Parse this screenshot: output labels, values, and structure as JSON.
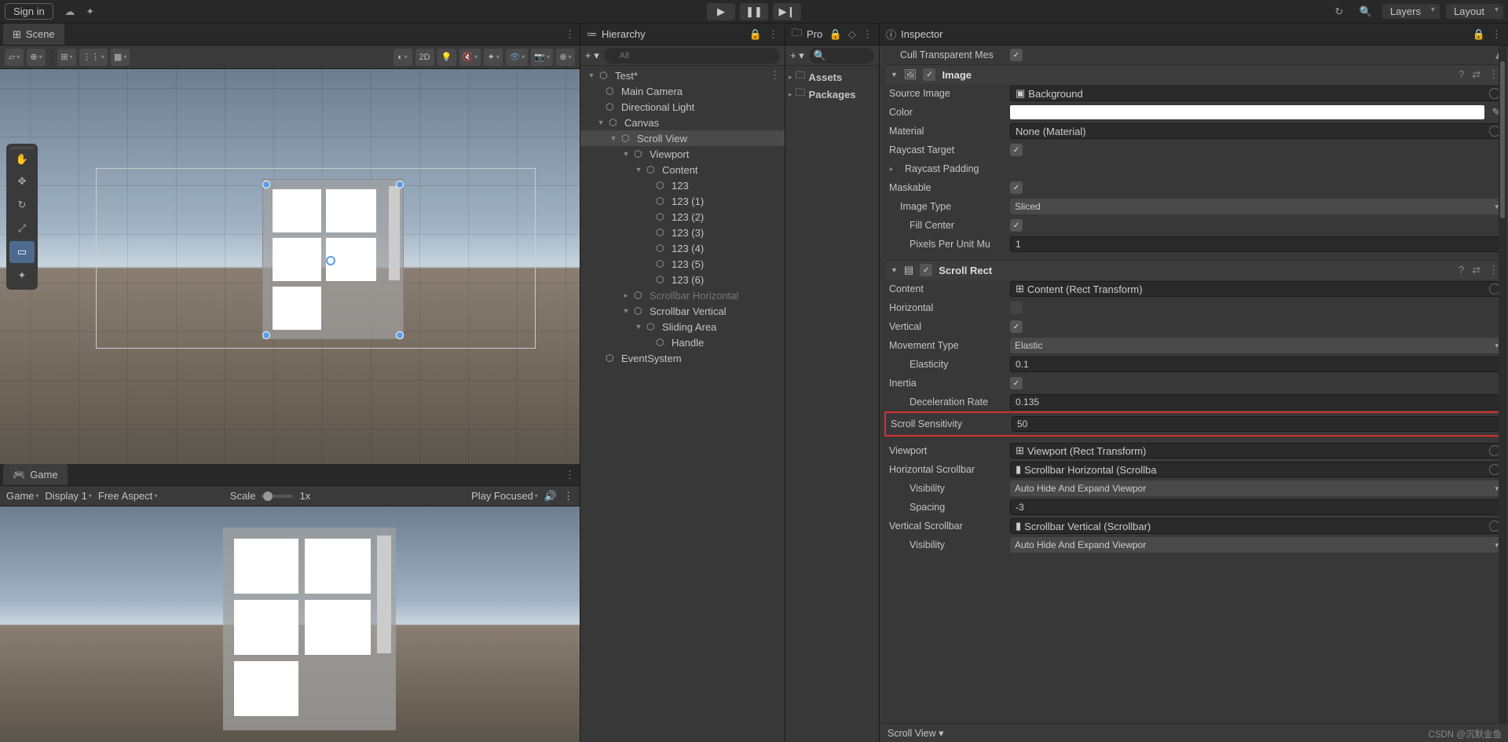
{
  "topbar": {
    "signin": "Sign in",
    "layers": "Layers",
    "layout": "Layout"
  },
  "scene": {
    "tab": "Scene",
    "btn2d": "2D"
  },
  "game": {
    "tab": "Game",
    "game": "Game",
    "display": "Display 1",
    "aspect": "Free Aspect",
    "scale_label": "Scale",
    "scale_value": "1x",
    "play_focused": "Play Focused"
  },
  "hierarchy": {
    "title": "Hierarchy",
    "search_placeholder": "All",
    "items": [
      "Test*",
      "Main Camera",
      "Directional Light",
      "Canvas",
      "Scroll View",
      "Viewport",
      "Content",
      "123",
      "123 (1)",
      "123 (2)",
      "123 (3)",
      "123 (4)",
      "123 (5)",
      "123 (6)",
      "Scrollbar Horizontal",
      "Scrollbar Vertical",
      "Sliding Area",
      "Handle",
      "EventSystem"
    ]
  },
  "project": {
    "title": "Pro",
    "assets": "Assets",
    "packages": "Packages"
  },
  "inspector": {
    "title": "Inspector",
    "cull_transparent": "Cull Transparent Mes",
    "image": {
      "title": "Image",
      "source_image_label": "Source Image",
      "source_image": "Background",
      "color_label": "Color",
      "material_label": "Material",
      "material": "None (Material)",
      "raycast_target_label": "Raycast Target",
      "raycast_padding_label": "Raycast Padding",
      "maskable_label": "Maskable",
      "image_type_label": "Image Type",
      "image_type": "Sliced",
      "fill_center_label": "Fill Center",
      "ppu_label": "Pixels Per Unit Mu",
      "ppu": "1"
    },
    "scroll_rect": {
      "title": "Scroll Rect",
      "content_label": "Content",
      "content": "Content (Rect Transform)",
      "horizontal_label": "Horizontal",
      "vertical_label": "Vertical",
      "movement_type_label": "Movement Type",
      "movement_type": "Elastic",
      "elasticity_label": "Elasticity",
      "elasticity": "0.1",
      "inertia_label": "Inertia",
      "deceleration_label": "Deceleration Rate",
      "deceleration": "0.135",
      "scroll_sensitivity_label": "Scroll Sensitivity",
      "scroll_sensitivity": "50",
      "viewport_label": "Viewport",
      "viewport": "Viewport (Rect Transform)",
      "horizontal_sb_label": "Horizontal Scrollbar",
      "horizontal_sb": "Scrollbar Horizontal (Scrollba",
      "visibility_label": "Visibility",
      "visibility1": "Auto Hide And Expand Viewpor",
      "spacing_label": "Spacing",
      "spacing": "-3",
      "vertical_sb_label": "Vertical Scrollbar",
      "vertical_sb": "Scrollbar Vertical (Scrollbar)",
      "visibility2": "Auto Hide And Expand Viewpor"
    },
    "footer_btn": "Scroll View ▾"
  },
  "watermark": "CSDN @沉默金鱼"
}
